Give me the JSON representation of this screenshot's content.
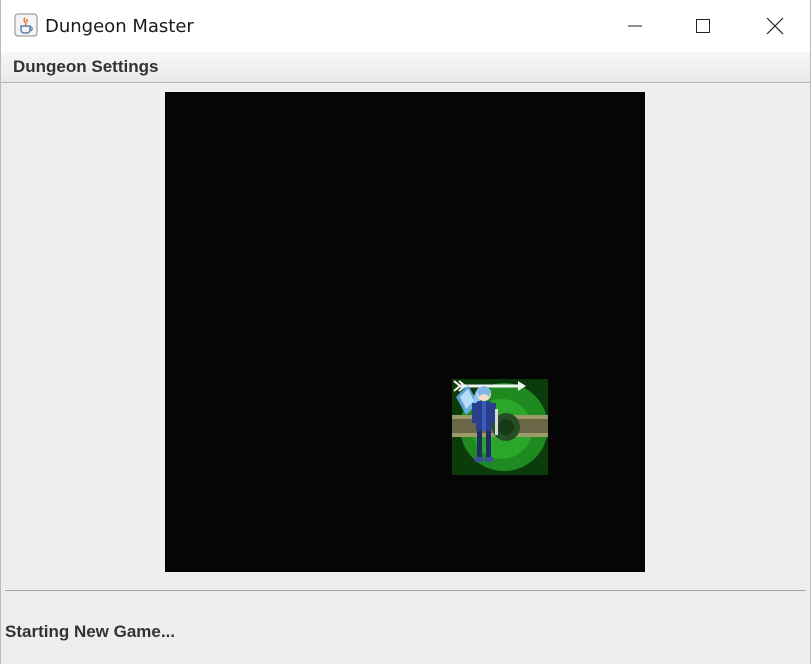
{
  "window": {
    "title": "Dungeon Master",
    "app_icon": "java-coffee-cup-icon",
    "controls": [
      "minimize-icon",
      "maximize-icon",
      "close-icon"
    ]
  },
  "menubar": {
    "items": [
      {
        "label": "Dungeon Settings"
      }
    ]
  },
  "board": {
    "background": "#050505",
    "player_tile": {
      "sprites": [
        "grass-tile",
        "dirt-road-tunnel",
        "arrow-icon",
        "blue-knight-character"
      ]
    }
  },
  "status": {
    "text": "Starting New Game..."
  },
  "colors": {
    "window_bg": "#eeeeee",
    "board_bg": "#050505",
    "grass": "#1f8a1f"
  }
}
